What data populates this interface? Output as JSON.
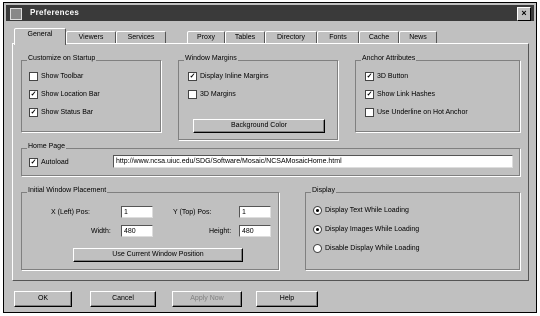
{
  "window": {
    "title": "Preferences"
  },
  "tabs": [
    {
      "label": "General"
    },
    {
      "label": "Viewers"
    },
    {
      "label": "Services"
    },
    {
      "label": "Proxy"
    },
    {
      "label": "Tables"
    },
    {
      "label": "Directory"
    },
    {
      "label": "Fonts"
    },
    {
      "label": "Cache"
    },
    {
      "label": "News"
    }
  ],
  "display_group": {
    "title": "Customize on Startup",
    "items": [
      {
        "label": "Show Toolbar",
        "checked": false
      },
      {
        "label": "Show Location Bar",
        "checked": true
      },
      {
        "label": "Show Status Bar",
        "checked": true
      }
    ]
  },
  "window_margins": {
    "title": "Window Margins",
    "items": [
      {
        "label": "Display Inline Margins",
        "checked": true
      },
      {
        "label": "3D Margins",
        "checked": false
      }
    ],
    "button": "Background Color"
  },
  "anchors": {
    "title": "Anchor Attributes",
    "items": [
      {
        "label": "3D Button",
        "checked": true
      },
      {
        "label": "Show Link Hashes",
        "checked": true
      },
      {
        "label": "Use Underline on Hot Anchor",
        "checked": false
      }
    ]
  },
  "home_page": {
    "title": "Home Page",
    "checkbox": "Autoload",
    "checked": true,
    "url": "http://www.ncsa.uiuc.edu/SDG/Software/Mosaic/NCSAMosaicHome.html"
  },
  "window_position": {
    "title": "Initial Window Placement",
    "x_label": "X (Left) Pos:",
    "x_value": "1",
    "y_label": "Y (Top) Pos:",
    "y_value": "1",
    "width_label": "Width:",
    "width_value": "480",
    "height_label": "Height:",
    "height_value": "480",
    "button": "Use Current Window Position"
  },
  "display": {
    "title": "Display",
    "items": [
      {
        "label": "Display Text While Loading",
        "selected": true
      },
      {
        "label": "Display Images While Loading",
        "selected": true
      },
      {
        "label": "Disable Display While Loading",
        "selected": false
      }
    ]
  },
  "footer": {
    "ok": "OK",
    "cancel": "Cancel",
    "apply": "Apply Now",
    "help": "Help"
  }
}
